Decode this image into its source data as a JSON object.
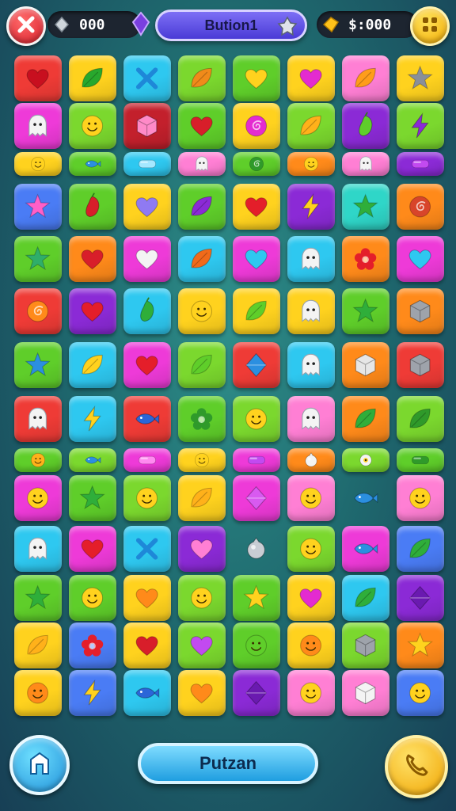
{
  "hud": {
    "gems_value": "000",
    "title": "Bution1",
    "coins_value": "$:000"
  },
  "icons": {
    "close": "close-icon",
    "gem": "gem-icon",
    "title_badge": "trophy-icon",
    "coin": "coin-icon",
    "menu": "menu-icon",
    "home": "home-icon",
    "phone": "phone-icon"
  },
  "main_button": {
    "label": "Putzan"
  },
  "palette": {
    "red": "#ef3b36",
    "yellow": "#ffd21e",
    "cyan": "#2ec8f0",
    "green": "#5fce2a",
    "lime": "#7bd82e",
    "magenta": "#ee3ad8",
    "pink": "#ff7fd4",
    "purple": "#8b2ad6",
    "orange": "#ff8a1a",
    "blue": "#4a7cf5",
    "teal": "#2fd6c8",
    "white": "#f4f4f4",
    "darkred": "#c3202c",
    "navy": "#2b66d8"
  },
  "board": {
    "rows": [
      [
        [
          "red",
          "heart",
          "#c80f1f"
        ],
        [
          "yellow",
          "leaf",
          "#28a82d"
        ],
        [
          "cyan",
          "x-fish",
          "#1e88d8"
        ],
        [
          "lime",
          "leaf",
          "#f08a1a"
        ],
        [
          "green",
          "heart",
          "#ffd21e"
        ],
        [
          "yellow",
          "heart",
          "#e42bd0"
        ],
        [
          "pink",
          "leaf",
          "#ff9d1a"
        ],
        [
          "yellow",
          "star",
          "#8a8f99"
        ]
      ],
      [
        [
          "magenta",
          "ghost",
          "#f4f4f4"
        ],
        [
          "lime",
          "smiley",
          "#ffd21e"
        ],
        [
          "darkred",
          "cube",
          "#ff8ac8"
        ],
        [
          "green",
          "heart",
          "#d81e2a"
        ],
        [
          "yellow",
          "swirl",
          "#e42bd0"
        ],
        [
          "lime",
          "leaf",
          "#ffb11a"
        ],
        [
          "purple",
          "pepper",
          "#5fce2a"
        ],
        [
          "lime",
          "bolt",
          "#8b2ad6"
        ]
      ],
      [
        [
          "yellow",
          "smiley",
          "#ffd21e"
        ],
        [
          "green",
          "fish",
          "#2b8fe0"
        ],
        [
          "cyan",
          "bar",
          "#a5e8ff"
        ],
        [
          "pink",
          "ghost",
          "#f4f4f4"
        ],
        [
          "green",
          "swirl",
          "#2f9a2a"
        ],
        [
          "orange",
          "smiley",
          "#ffd21e"
        ],
        [
          "pink",
          "ghost",
          "#f4f4f4"
        ],
        [
          "purple",
          "bar",
          "#c24af0"
        ]
      ],
      [
        [
          "blue",
          "star",
          "#ff5fc8"
        ],
        [
          "green",
          "pepper",
          "#d81e2a"
        ],
        [
          "yellow",
          "heart",
          "#8f7af2"
        ],
        [
          "green",
          "leaf",
          "#8b2ad6"
        ],
        [
          "yellow",
          "heart",
          "#e41e2a"
        ],
        [
          "purple",
          "bolt",
          "#ffd21e"
        ],
        [
          "teal",
          "star",
          "#2fae3a"
        ],
        [
          "orange",
          "swirl",
          "#d8452a"
        ]
      ],
      [
        [
          "green",
          "star",
          "#2fae6a"
        ],
        [
          "orange",
          "heart",
          "#d81e2a"
        ],
        [
          "magenta",
          "heart",
          "#f4f4f4"
        ],
        [
          "cyan",
          "leaf",
          "#f06a1a"
        ],
        [
          "magenta",
          "heart",
          "#2ec8f0"
        ],
        [
          "cyan",
          "ghost",
          "#f4f4f4"
        ],
        [
          "orange",
          "flower",
          "#e41e2a"
        ],
        [
          "magenta",
          "heart",
          "#2ec8f0"
        ]
      ],
      [
        [
          "red",
          "swirl",
          "#ff8a1a"
        ],
        [
          "purple",
          "heart",
          "#e41e2a"
        ],
        [
          "cyan",
          "pepper",
          "#2fae3a"
        ],
        [
          "yellow",
          "smiley",
          "#ffd21e"
        ],
        [
          "yellow",
          "leaf",
          "#5fce2a"
        ],
        [
          "yellow",
          "ghost",
          "#f4f4f4"
        ],
        [
          "green",
          "star",
          "#2fae3a"
        ],
        [
          "orange",
          "cube",
          "#9ea3ab"
        ]
      ],
      [
        [
          "green",
          "star",
          "#2b8fe0"
        ],
        [
          "cyan",
          "leaf",
          "#ffd21e"
        ],
        [
          "magenta",
          "heart",
          "#e41e2a"
        ],
        [
          "lime",
          "leaf",
          "#5fce2a"
        ],
        [
          "red",
          "diamond",
          "#2b8fe0"
        ],
        [
          "cyan",
          "ghost",
          "#f4f4f4"
        ],
        [
          "orange",
          "cube",
          "#e6e6e6"
        ],
        [
          "red",
          "cube",
          "#9ea3ab"
        ]
      ],
      [
        [
          "red",
          "ghost",
          "#f4f4f4"
        ],
        [
          "cyan",
          "bolt",
          "#ffd21e"
        ],
        [
          "red",
          "fish",
          "#2b66d8"
        ],
        [
          "green",
          "flower",
          "#2f9a2a"
        ],
        [
          "lime",
          "smiley",
          "#ffd21e"
        ],
        [
          "pink",
          "ghost",
          "#f4f4f4"
        ],
        [
          "orange",
          "leaf",
          "#2fae3a"
        ],
        [
          "lime",
          "leaf",
          "#2f9a2a"
        ]
      ],
      [
        [
          "green",
          "smiley",
          "#ffb11a"
        ],
        [
          "lime",
          "fish",
          "#2b8fe0"
        ],
        [
          "magenta",
          "bar",
          "#ff8af0"
        ],
        [
          "yellow",
          "smiley",
          "#ffd21e"
        ],
        [
          "magenta",
          "bar",
          "#c24af0"
        ],
        [
          "orange",
          "orb",
          "#f4f4f4"
        ],
        [
          "lime",
          "eye",
          "#ffd21e"
        ],
        [
          "green",
          "bar",
          "#2f9a2a"
        ]
      ],
      [
        [
          "magenta",
          "smiley",
          "#ffd21e"
        ],
        [
          "green",
          "star",
          "#2fae3a"
        ],
        [
          "lime",
          "smiley",
          "#ffd21e"
        ],
        [
          "yellow",
          "leaf",
          "#ffb11a"
        ],
        [
          "magenta",
          "diamond",
          "#d85af0"
        ],
        [
          "pink",
          "smiley",
          "#ffd21e"
        ],
        [
          "none",
          "fish",
          "#2b8fe0"
        ],
        [
          "pink",
          "smiley",
          "#ffd21e"
        ]
      ],
      [
        [
          "cyan",
          "ghost",
          "#f4f4f4"
        ],
        [
          "magenta",
          "heart",
          "#e41e2a"
        ],
        [
          "cyan",
          "x-fish",
          "#1e88d8"
        ],
        [
          "purple",
          "heart",
          "#ff7fd4"
        ],
        [
          "none",
          "orb",
          "#c9cdd4"
        ],
        [
          "lime",
          "smiley",
          "#ffd21e"
        ],
        [
          "magenta",
          "fish",
          "#2b8fe0"
        ],
        [
          "blue",
          "leaf",
          "#2fae3a"
        ]
      ],
      [
        [
          "green",
          "star",
          "#2fae3a"
        ],
        [
          "green",
          "smiley",
          "#ffd21e"
        ],
        [
          "yellow",
          "heart",
          "#ff8a1a"
        ],
        [
          "lime",
          "smiley",
          "#ffd21e"
        ],
        [
          "green",
          "star",
          "#ffd21e"
        ],
        [
          "yellow",
          "heart",
          "#e42bd0"
        ],
        [
          "cyan",
          "leaf",
          "#2fae3a"
        ],
        [
          "purple",
          "diamond",
          "#6a1ab0"
        ]
      ],
      [
        [
          "yellow",
          "leaf",
          "#ffb11a"
        ],
        [
          "blue",
          "flower",
          "#e41e2a"
        ],
        [
          "yellow",
          "heart",
          "#d81e2a"
        ],
        [
          "lime",
          "heart",
          "#c24af0"
        ],
        [
          "green",
          "smiley",
          "#5fce2a"
        ],
        [
          "yellow",
          "smiley",
          "#ff8a1a"
        ],
        [
          "lime",
          "cube",
          "#9ea3ab"
        ],
        [
          "orange",
          "star",
          "#ffd21e"
        ]
      ],
      [
        [
          "yellow",
          "smiley",
          "#ff8a1a"
        ],
        [
          "blue",
          "bolt",
          "#ffd21e"
        ],
        [
          "cyan",
          "fish",
          "#2b66d8"
        ],
        [
          "yellow",
          "heart",
          "#ff8a1a"
        ],
        [
          "purple",
          "diamond",
          "#6a1ab0"
        ],
        [
          "pink",
          "smiley",
          "#ffd21e"
        ],
        [
          "pink",
          "cube",
          "#f4f4f4"
        ],
        [
          "blue",
          "smiley",
          "#ffd21e"
        ]
      ]
    ]
  }
}
